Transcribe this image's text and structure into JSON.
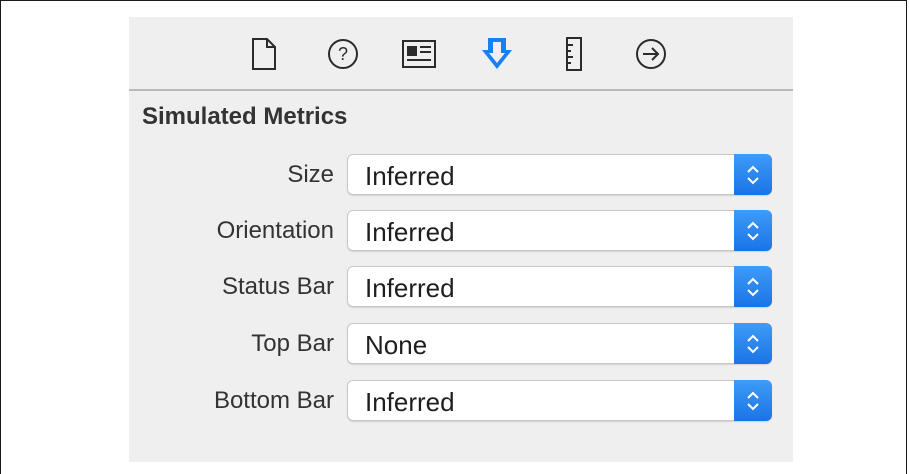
{
  "toolbar": {
    "icons": [
      "file-icon",
      "help-icon",
      "identity-icon",
      "attributes-icon",
      "size-icon",
      "connections-icon"
    ],
    "accent": "#1a7ef4"
  },
  "section": {
    "title": "Simulated Metrics"
  },
  "metrics": [
    {
      "label": "Size",
      "value": "Inferred"
    },
    {
      "label": "Orientation",
      "value": "Inferred"
    },
    {
      "label": "Status Bar",
      "value": "Inferred"
    },
    {
      "label": "Top Bar",
      "value": "None"
    },
    {
      "label": "Bottom Bar",
      "value": "Inferred"
    }
  ]
}
